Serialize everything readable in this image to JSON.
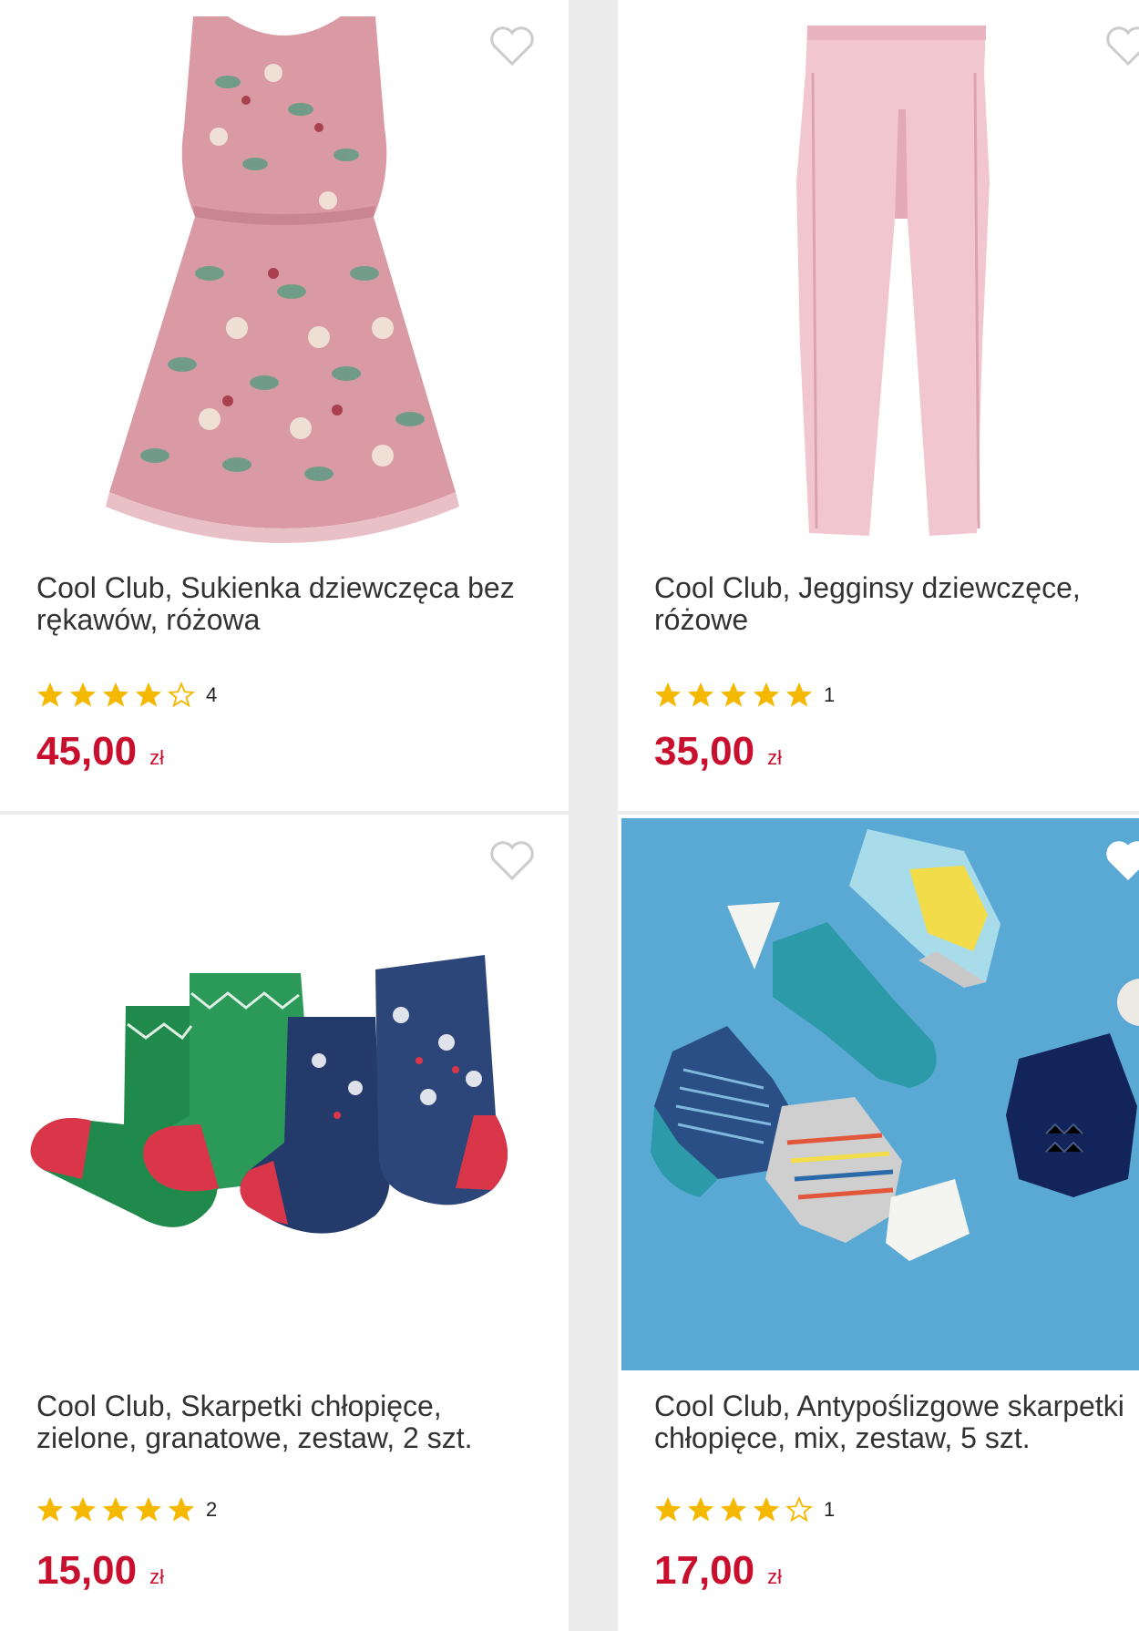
{
  "colors": {
    "price": "#c8102e",
    "star": "#f5b800",
    "background": "#ececec"
  },
  "products": [
    {
      "title": "Cool Club, Sukienka dziewczęca bez rękawów, różowa",
      "rating": 4,
      "rating_count": "4",
      "price": "45,00",
      "currency": "zł",
      "image_icon": "pink-floral-dress-image"
    },
    {
      "title": "Cool Club, Jegginsy dziewczęce, różowe",
      "rating": 5,
      "rating_count": "1",
      "price": "35,00",
      "currency": "zł",
      "image_icon": "pink-leggings-image"
    },
    {
      "title": "Cool Club, Skarpetki chłopięce, zielone, granatowe, zestaw, 2 szt.",
      "rating": 5,
      "rating_count": "2",
      "price": "15,00",
      "currency": "zł",
      "image_icon": "christmas-socks-image"
    },
    {
      "title": "Cool Club, Antypoślizgowe skarpetki chłopięce, mix, zestaw, 5 szt.",
      "rating": 4,
      "rating_count": "1",
      "price": "17,00",
      "currency": "zł",
      "image_icon": "baby-socks-set-image"
    }
  ]
}
